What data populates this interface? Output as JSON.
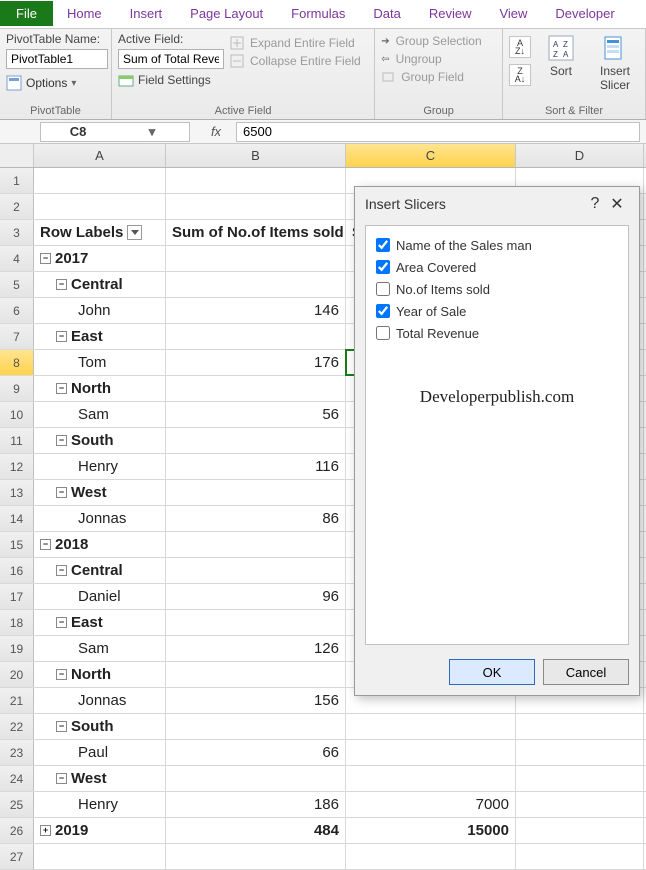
{
  "ribbon_tabs": {
    "file": "File",
    "home": "Home",
    "insert": "Insert",
    "page_layout": "Page Layout",
    "formulas": "Formulas",
    "data": "Data",
    "review": "Review",
    "view": "View",
    "developer": "Developer"
  },
  "pivottable_group": {
    "name_label": "PivotTable Name:",
    "name_value": "PivotTable1",
    "options_label": "Options",
    "group_label": "PivotTable"
  },
  "activefield_group": {
    "label": "Active Field:",
    "value": "Sum of Total Reve",
    "field_settings": "Field Settings",
    "expand": "Expand Entire Field",
    "collapse": "Collapse Entire Field",
    "group_label": "Active Field"
  },
  "group_group": {
    "selection": "Group Selection",
    "ungroup": "Ungroup",
    "field": "Group Field",
    "group_label": "Group"
  },
  "sort_group": {
    "sort_label": "Sort",
    "insert_slicer": "Insert\nSlicer",
    "group_label": "Sort & Filter"
  },
  "formula_bar": {
    "name_box": "C8",
    "fx": "fx",
    "value": "6500"
  },
  "columns": {
    "A": "A",
    "B": "B",
    "C": "C",
    "D": "D"
  },
  "headers": {
    "row_labels": "Row Labels",
    "col_b": "Sum of No.of Items sold",
    "col_c_prefix": "S"
  },
  "pivot_rows": [
    {
      "r": 4,
      "a_type": "parent",
      "a": "2017"
    },
    {
      "r": 5,
      "a_type": "region",
      "a": "Central"
    },
    {
      "r": 6,
      "a_type": "leaf",
      "a": "John",
      "b": "146"
    },
    {
      "r": 7,
      "a_type": "region",
      "a": "East"
    },
    {
      "r": 8,
      "a_type": "leaf",
      "a": "Tom",
      "b": "176"
    },
    {
      "r": 9,
      "a_type": "region",
      "a": "North"
    },
    {
      "r": 10,
      "a_type": "leaf",
      "a": "Sam",
      "b": "56"
    },
    {
      "r": 11,
      "a_type": "region",
      "a": "South"
    },
    {
      "r": 12,
      "a_type": "leaf",
      "a": "Henry",
      "b": "116"
    },
    {
      "r": 13,
      "a_type": "region",
      "a": "West"
    },
    {
      "r": 14,
      "a_type": "leaf",
      "a": "Jonnas",
      "b": "86"
    },
    {
      "r": 15,
      "a_type": "parent",
      "a": "2018"
    },
    {
      "r": 16,
      "a_type": "region",
      "a": "Central"
    },
    {
      "r": 17,
      "a_type": "leaf",
      "a": "Daniel",
      "b": "96"
    },
    {
      "r": 18,
      "a_type": "region",
      "a": "East"
    },
    {
      "r": 19,
      "a_type": "leaf",
      "a": "Sam",
      "b": "126"
    },
    {
      "r": 20,
      "a_type": "region",
      "a": "North"
    },
    {
      "r": 21,
      "a_type": "leaf",
      "a": "Jonnas",
      "b": "156"
    },
    {
      "r": 22,
      "a_type": "region",
      "a": "South"
    },
    {
      "r": 23,
      "a_type": "leaf",
      "a": "Paul",
      "b": "66"
    },
    {
      "r": 24,
      "a_type": "region",
      "a": "West"
    },
    {
      "r": 25,
      "a_type": "leaf",
      "a": "Henry",
      "b": "186",
      "c": "7000"
    },
    {
      "r": 26,
      "a_type": "parent_collapsed",
      "a": "2019",
      "b": "484",
      "c": "15000"
    },
    {
      "r": 27,
      "a_type": "blank"
    }
  ],
  "dialog": {
    "title": "Insert Slicers",
    "help": "?",
    "options": [
      {
        "label": "Name of the Sales man",
        "checked": true
      },
      {
        "label": "Area Covered",
        "checked": true
      },
      {
        "label": "No.of Items sold",
        "checked": false
      },
      {
        "label": "Year of Sale",
        "checked": true
      },
      {
        "label": "Total Revenue",
        "checked": false
      }
    ],
    "watermark": "Developerpublish.com",
    "ok": "OK",
    "cancel": "Cancel"
  }
}
